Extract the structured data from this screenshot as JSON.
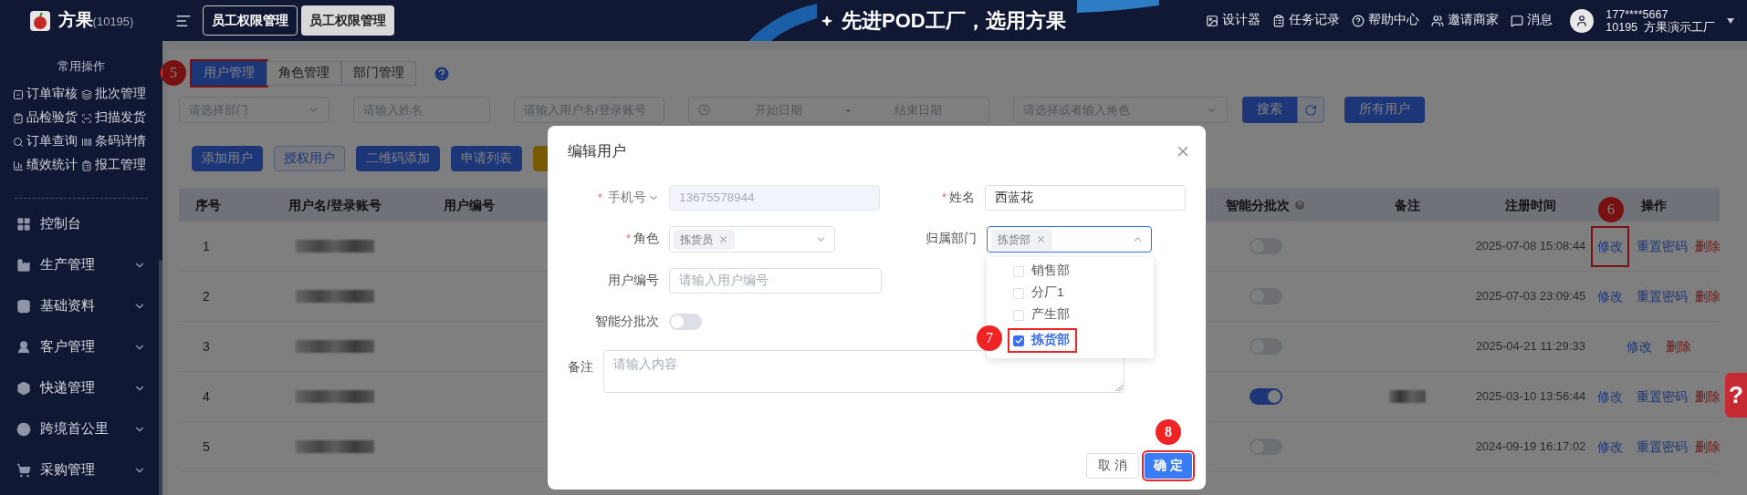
{
  "app": {
    "logo_text": "方果",
    "account_id": "(10195)"
  },
  "top_tabs": [
    {
      "label": "员工权限管理",
      "selected": false
    },
    {
      "label": "员工权限管理",
      "selected": true
    }
  ],
  "banner": {
    "slogan": "先进POD工厂，选用方果"
  },
  "header_links": [
    "设计器",
    "任务记录",
    "帮助中心",
    "邀请商家",
    "消息"
  ],
  "user": {
    "phone": "177****5667",
    "company": "10195  方果演示工厂"
  },
  "sidebar": {
    "quick_title": "常用操作",
    "quick_actions": [
      "订单审核",
      "批次管理",
      "品检验货",
      "扫描发货",
      "订单查询",
      "条码详情",
      "绩效统计",
      "报工管理"
    ],
    "menu": [
      {
        "label": "控制台",
        "kind": "link"
      },
      {
        "label": "生产管理",
        "kind": "group",
        "expanded": false
      },
      {
        "label": "基础资料",
        "kind": "group",
        "expanded": false
      },
      {
        "label": "客户管理",
        "kind": "group",
        "expanded": false
      },
      {
        "label": "快递管理",
        "kind": "group",
        "expanded": false
      },
      {
        "label": "跨境首公里",
        "kind": "group",
        "expanded": false
      },
      {
        "label": "采购管理",
        "kind": "group",
        "expanded": false
      }
    ]
  },
  "page_tabs": [
    {
      "label": "用户管理",
      "selected": true,
      "annotation": "5"
    },
    {
      "label": "角色管理",
      "selected": false
    },
    {
      "label": "部门管理",
      "selected": false
    }
  ],
  "filters": [
    {
      "kind": "select",
      "placeholder": "请选择部门"
    },
    {
      "kind": "input",
      "placeholder": "请输入姓名"
    },
    {
      "kind": "input",
      "placeholder": "请输入用户名/登录账号"
    },
    {
      "kind": "date_range",
      "start_placeholder": "开始日期",
      "separator": "-",
      "end_placeholder": "结束日期"
    },
    {
      "kind": "select",
      "placeholder": "请选择或者输入角色"
    }
  ],
  "search_button": "搜索",
  "all_users_button": "所有用户",
  "actions": [
    {
      "kind": "primary",
      "label": "添加用户"
    },
    {
      "kind": "outline",
      "label": "授权用户"
    },
    {
      "kind": "primary",
      "label": "二维码添加"
    },
    {
      "kind": "primary",
      "label": "申请列表"
    },
    {
      "kind": "warning"
    }
  ],
  "table": {
    "columns": [
      "序号",
      "用户名/登录账号",
      "用户编号",
      "智能分批次",
      "备注",
      "注册时间",
      "操作"
    ],
    "rows": [
      {
        "index": "1",
        "username_redacted": true,
        "smart_batch": false,
        "note_redacted": false,
        "registered": "2025-07-08 15:08:44",
        "actions": [
          {
            "kind": "edit",
            "label": "修改",
            "highlighted": true,
            "annotation": "6"
          },
          {
            "kind": "reset",
            "label": "重置密码"
          },
          {
            "kind": "delete",
            "label": "删除"
          }
        ]
      },
      {
        "index": "2",
        "username_redacted": true,
        "smart_batch": false,
        "note_redacted": false,
        "registered": "2025-07-03 23:09:45",
        "actions": [
          {
            "kind": "edit",
            "label": "修改",
            "highlighted": false
          },
          {
            "kind": "reset",
            "label": "重置密码"
          },
          {
            "kind": "delete",
            "label": "删除"
          }
        ]
      },
      {
        "index": "3",
        "username_redacted": true,
        "smart_batch": false,
        "note_redacted": false,
        "registered": "2025-04-21 11:29:33",
        "actions": [
          {
            "kind": "edit",
            "label": "修改",
            "highlighted": false
          },
          {
            "kind": "delete",
            "label": "删除"
          }
        ]
      },
      {
        "index": "4",
        "username_redacted": true,
        "smart_batch": true,
        "note_redacted": true,
        "registered": "2025-03-10 13:56:44",
        "actions": [
          {
            "kind": "edit",
            "label": "修改",
            "highlighted": false
          },
          {
            "kind": "reset",
            "label": "重置密码"
          },
          {
            "kind": "delete",
            "label": "删除"
          }
        ]
      },
      {
        "index": "5",
        "username_redacted": true,
        "smart_batch": false,
        "note_redacted": false,
        "registered": "2024-09-19 16:17:02",
        "actions": [
          {
            "kind": "edit",
            "label": "修改",
            "highlighted": false
          },
          {
            "kind": "reset",
            "label": "重置密码"
          },
          {
            "kind": "delete",
            "label": "删除"
          }
        ]
      }
    ]
  },
  "help_tab": "?",
  "dialog": {
    "title": "编辑用户",
    "phone": {
      "label": "手机号",
      "required_mark": "*",
      "value": "13675578944",
      "disabled": true
    },
    "name": {
      "label": "姓名",
      "required_mark": "*",
      "value": "西蓝花"
    },
    "role": {
      "label": "角色",
      "required_mark": "*",
      "tags": [
        "拣货员"
      ]
    },
    "department": {
      "label": "归属部门",
      "tags": [
        "拣货部"
      ],
      "expanded": true,
      "options": [
        {
          "label": "销售部",
          "checked": false,
          "highlighted": false
        },
        {
          "label": "分厂1",
          "checked": false,
          "highlighted": false
        },
        {
          "label": "产生部",
          "checked": false,
          "highlighted": false
        },
        {
          "label": "拣货部",
          "checked": true,
          "highlighted": true,
          "annotation": "7"
        }
      ]
    },
    "user_no": {
      "label": "用户编号",
      "placeholder": "请输入用户编号"
    },
    "smart_batch": {
      "label": "智能分批次",
      "on": false
    },
    "note": {
      "label": "备注",
      "placeholder": "请输入内容"
    },
    "cancel_button": {
      "label": "取 消",
      "highlighted": false
    },
    "confirm_button": {
      "label": "确 定",
      "highlighted": true,
      "annotation": "8"
    }
  }
}
